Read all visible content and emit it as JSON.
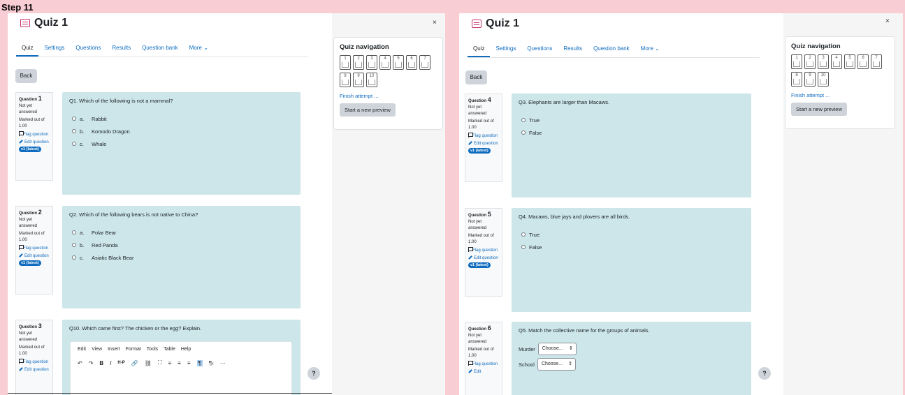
{
  "step_label": "Step 11",
  "left": {
    "title": "Quiz 1",
    "tabs": [
      "Quiz",
      "Settings",
      "Questions",
      "Results",
      "Question bank",
      "More ⌄"
    ],
    "back_label": "Back",
    "questions": [
      {
        "label": "Question",
        "number": "1",
        "status": "Not yet answered",
        "marked": "Marked out of 1.00",
        "flag": "Flag question",
        "edit": "Edit question",
        "version": "v1 (latest)",
        "text": "Q1. Which of the following is not a mammal?",
        "options": [
          {
            "letter": "a.",
            "text": "Rabbit"
          },
          {
            "letter": "b.",
            "text": "Komodo Dragon"
          },
          {
            "letter": "c.",
            "text": "Whale"
          }
        ]
      },
      {
        "label": "Question",
        "number": "2",
        "status": "Not yet answered",
        "marked": "Marked out of 1.00",
        "flag": "Flag question",
        "edit": "Edit question",
        "version": "v1 (latest)",
        "text": "Q2. Which of the following bears is not native to China?",
        "options": [
          {
            "letter": "a.",
            "text": "Polar Bear"
          },
          {
            "letter": "b.",
            "text": "Red Panda"
          },
          {
            "letter": "c.",
            "text": "Asiatic Black Bear"
          }
        ]
      },
      {
        "label": "Question",
        "number": "3",
        "status": "Not yet answered",
        "marked": "Marked out of 1.00",
        "flag": "Flag question",
        "edit": "Edit question",
        "text": "Q10. Which came first? The chicken or the egg? Explain.",
        "editor_menu": [
          "Edit",
          "View",
          "Insert",
          "Format",
          "Tools",
          "Table",
          "Help"
        ],
        "editor_tools": [
          "↶",
          "↷",
          "B",
          "I",
          "H-P",
          "🔗",
          "⛓",
          "⛶",
          "≡",
          "≡",
          "≡",
          "¶",
          "¶‹",
          "···"
        ]
      }
    ],
    "nav": {
      "title": "Quiz navigation",
      "buttons": [
        "1",
        "2",
        "3",
        "4",
        "5",
        "6",
        "7",
        "8",
        "9",
        "10"
      ],
      "finish": "Finish attempt ...",
      "preview": "Start a new preview"
    },
    "close": "×",
    "help": "?"
  },
  "right": {
    "title": "Quiz 1",
    "tabs": [
      "Quiz",
      "Settings",
      "Questions",
      "Results",
      "Question bank",
      "More ⌄"
    ],
    "back_label": "Back",
    "questions": [
      {
        "label": "Question",
        "number": "4",
        "status": "Not yet answered",
        "marked": "Marked out of 1.00",
        "flag": "Flag question",
        "edit": "Edit question",
        "version": "v1 (latest)",
        "text": "Q3. Elephants are larger than Macaws.",
        "options": [
          {
            "text": "True"
          },
          {
            "text": "False"
          }
        ]
      },
      {
        "label": "Question",
        "number": "5",
        "status": "Not yet answered",
        "marked": "Marked out of 1.00",
        "flag": "Flag question",
        "edit": "Edit question",
        "version": "v1 (latest)",
        "text": "Q4. Macaws, blue jays and plovers are all birds.",
        "options": [
          {
            "text": "True"
          },
          {
            "text": "False"
          }
        ]
      },
      {
        "label": "Question",
        "number": "6",
        "status": "Not yet answered",
        "marked": "Marked out of 1.00",
        "flag": "Flag question",
        "edit": "Edit",
        "text": "Q5. Match the collective name for the groups of animals.",
        "matches": [
          {
            "label": "Murder",
            "value": "Choose..."
          },
          {
            "label": "School",
            "value": "Choose..."
          }
        ]
      }
    ],
    "nav": {
      "title": "Quiz navigation",
      "buttons": [
        "1",
        "2",
        "3",
        "4",
        "5",
        "6",
        "7",
        "8",
        "9",
        "10"
      ],
      "finish": "Finish attempt ...",
      "preview": "Start a new preview"
    },
    "close": "×",
    "help": "?"
  }
}
